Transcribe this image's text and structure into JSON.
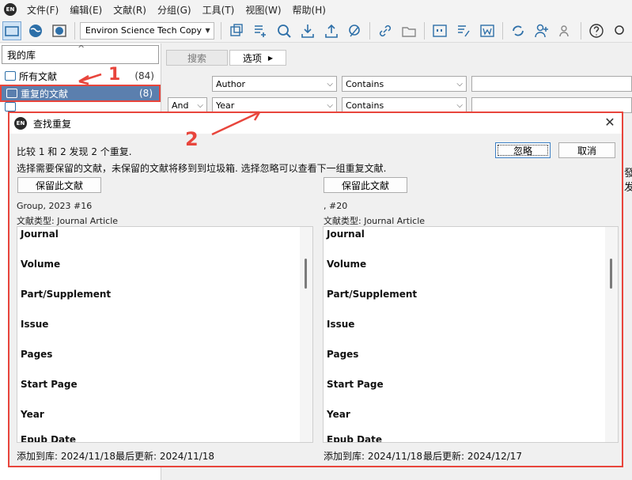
{
  "menu": {
    "logo": "EN",
    "items": [
      "文件(F)",
      "编辑(E)",
      "文献(R)",
      "分组(G)",
      "工具(T)",
      "视图(W)",
      "帮助(H)"
    ]
  },
  "toolbar": {
    "style_value": "Environ Science Tech Copy"
  },
  "library": {
    "header": "我的库",
    "groups": [
      {
        "label": "所有文献",
        "count": "(84)"
      },
      {
        "label": "重复的文献",
        "count": "(8)"
      }
    ]
  },
  "search": {
    "search_button": "搜索",
    "options_button": "选项",
    "rows": [
      {
        "connector": "",
        "field": "Author",
        "operator": "Contains"
      },
      {
        "connector": "And",
        "field": "Year",
        "operator": "Contains"
      }
    ]
  },
  "background_right": [
    "發",
    "发"
  ],
  "annotations": {
    "one": "1",
    "two": "2"
  },
  "dialog": {
    "title": "查找重复",
    "close": "✕",
    "message_line1": "比较 1 和 2 发现 2 个重复.",
    "message_line2": "选择需要保留的文献，未保留的文献将移到到垃圾箱. 选择忽略可以查看下一组重复文献.",
    "skip_button": "忽略",
    "cancel_button": "取消",
    "left": {
      "keep_button": "保留此文献",
      "ref_line": "Group, 2023 #16",
      "type_line": "文献类型: Journal Article",
      "fields": [
        "Journal",
        "Volume",
        "Part/Supplement",
        "Issue",
        "Pages",
        "Start Page",
        "Year",
        "Epub Date"
      ],
      "added": "添加到库: 2024/11/18",
      "updated": "最后更新: 2024/11/18"
    },
    "right": {
      "keep_button": "保留此文献",
      "ref_line": ",  #20",
      "type_line": "文献类型: Journal Article",
      "fields": [
        "Journal",
        "Volume",
        "Part/Supplement",
        "Issue",
        "Pages",
        "Start Page",
        "Year",
        "Epub Date"
      ],
      "added": "添加到库: 2024/11/18",
      "updated": "最后更新: 2024/12/17"
    }
  }
}
